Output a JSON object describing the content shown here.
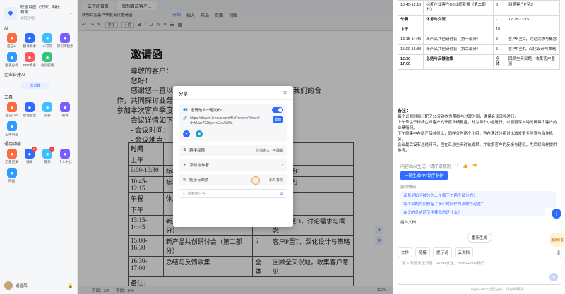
{
  "sidebar": {
    "org_name": "联想百应（天津）科技有限...",
    "org_sub": "百应小组",
    "section_ai": "AI",
    "ai_apps": [
      {
        "label": "百应AI",
        "icon": "ai-icon",
        "color": "#ff6a3d"
      },
      {
        "label": "翻译助手",
        "icon": "translate-icon",
        "color": "#2f6bff"
      },
      {
        "label": "AI写作",
        "icon": "pen-icon",
        "color": "#3cc0ff"
      },
      {
        "label": "知识库检索",
        "icon": "book-icon",
        "color": "#7b5cff"
      },
      {
        "label": "图表分析",
        "icon": "chart-icon",
        "color": "#2f9bff"
      },
      {
        "label": "PPT助手",
        "icon": "ppt-icon",
        "color": "#ff5a5a"
      },
      {
        "label": "会议纪要",
        "icon": "meeting-icon",
        "color": "#37c37a"
      }
    ],
    "section_enterprise": "企业自建AI",
    "create_label": "去创建",
    "section_tools": "工具",
    "tools": [
      {
        "label": "百应Lab",
        "icon": "lab-icon"
      },
      {
        "label": "管理后台",
        "icon": "admin-icon"
      },
      {
        "label": "设备",
        "icon": "device-icon"
      },
      {
        "label": "服务",
        "icon": "service-icon"
      },
      {
        "label": "应用商店",
        "icon": "store-icon"
      }
    ],
    "section_common": "通用功能",
    "common": [
      {
        "label": "历史记录",
        "icon": "history-icon",
        "badge": ""
      },
      {
        "label": "通知",
        "icon": "bell-icon",
        "badge": "2"
      },
      {
        "label": "聊天",
        "icon": "chat-icon",
        "badge": "1"
      },
      {
        "label": "个人中心",
        "icon": "user-icon",
        "badge": ""
      },
      {
        "label": "网盘",
        "icon": "cloud-icon",
        "badge": ""
      }
    ],
    "user_name": "逍遥风"
  },
  "doc": {
    "tabs": [
      "云空间首页",
      "联想百应客户..."
    ],
    "file_title": "联想百应客户季度会议邀请函...",
    "ribbon_tabs": [
      "开始",
      "插入",
      "布局",
      "页面",
      "视图"
    ],
    "font_name": "宋体",
    "font_size": "小四",
    "title": "邀请函",
    "lines": [
      "尊敬的客户：",
      "您好！",
      "感谢您一直以来对联想百应的支持，我们诚邀您参加我们的合",
      "作，共同探讨业务发展的新机遇，我们诚挚地诚挚地请您",
      "参加本次客户季度会议。",
      "会议详情如下：",
      "- 会议时间：",
      "- 会议地点："
    ],
    "table_header": [
      "时间",
      "",
      "",
      "备注"
    ],
    "table_rows": [
      [
        "上午",
        "",
        "",
        ""
      ],
      [
        "9:00-10:30",
        "标杆企业...部分",
        "",
        "客户P至E"
      ],
      [
        "10:45-12:15",
        "标杆企业...部分",
        "",
        "客户P至J"
      ],
      [
        "午餐",
        "休息",
        "",
        ""
      ],
      [
        "下午",
        "",
        "",
        ""
      ],
      [
        "13:15-14:45",
        "新产品共创研讨会（第一部分）",
        "5",
        "客户K至O，讨论需求与概念"
      ],
      [
        "15:00-16:30",
        "新产品共创研讨会（第二部分）",
        "5",
        "客户P至T，深化设计与策略"
      ],
      [
        "16:30-17:00",
        "总结与反馈收集",
        "全体",
        "回顾全天议题，收集客户意见"
      ]
    ],
    "table_footer": "备注：",
    "status_page": "页面：1/2",
    "status_words": "字数：845",
    "status_zoom": "122%"
  },
  "share": {
    "title": "分享",
    "collab_label": "邀请他人一起协作",
    "link": "https://daweii.lenovo.com/filePreview?shareId=kMzv723ttys4xEvxAW0s",
    "copy_label": "复制",
    "perm_label": "链接权限",
    "perm_scope": "仅指定人",
    "perm_value": "可编辑",
    "add_label": "添加协作者",
    "expire_label": "链接有效期",
    "expire_value": "永久有效",
    "search_placeholder": "搜索用户名"
  },
  "right": {
    "rows": [
      [
        "10:45-12:15",
        "标杆企业客户Q3业绩复盘（第二部分）",
        "5",
        "涵盖客户P至J"
      ],
      [
        "午餐",
        "休息与交流",
        "-",
        "12:15-13:15"
      ],
      [
        "下午",
        "",
        "10",
        ""
      ],
      [
        "13:15-14:45",
        "新产品共创研讨会（第一部分）",
        "5",
        "客户K至O，讨论需求与概念"
      ],
      [
        "15:00-16:30",
        "新产品共创研讨会（第二部分）",
        "5",
        "客户P至T，深化设计与策略"
      ],
      [
        "16:30-17:00",
        "总结与反馈收集",
        "全体",
        "回顾全天议题，收集客户意见"
      ]
    ],
    "notes_title": "备注：",
    "notes": [
      "每个议题时间分配了15分钟作为茶歇与过渡时间，确保会议流畅进行。",
      "上午专注于标杆企业客户的季度业绩复盘，分为两个小组进行，以便更深入地分析每个客户的业绩情况。",
      "下午则集中在新产品共创上，同样分为两个小组，旨在通过分组讨论激发更多创意与合作机会。",
      "会议最后设有总结环节，旨在汇总全天讨论成果，并收集客户的反馈与建议，为后续合作提供参考。"
    ],
    "ai_note": "内容由AI生成，请仔细甄别",
    "ppt_button": "一键生成PPT助手制作",
    "guess_label": "猜你想问：",
    "suggestions": [
      "议题是如何被分为上午和下午两个部分的？",
      "每个议题时间预留了多少时间作为茶歇与过渡？",
      "会议的总结环节主要目的是什么？"
    ],
    "insert_doc": "插入文档",
    "regen": "重新生成",
    "tools": [
      "文件",
      "链接",
      "提示词",
      "云文档"
    ],
    "input_placeholder": "输入问题发送消息，Enter发送，Shift+Enter换行",
    "footer": "内容由AI大模型生成，请仔细甄别",
    "helper_label": "邀请好友"
  }
}
